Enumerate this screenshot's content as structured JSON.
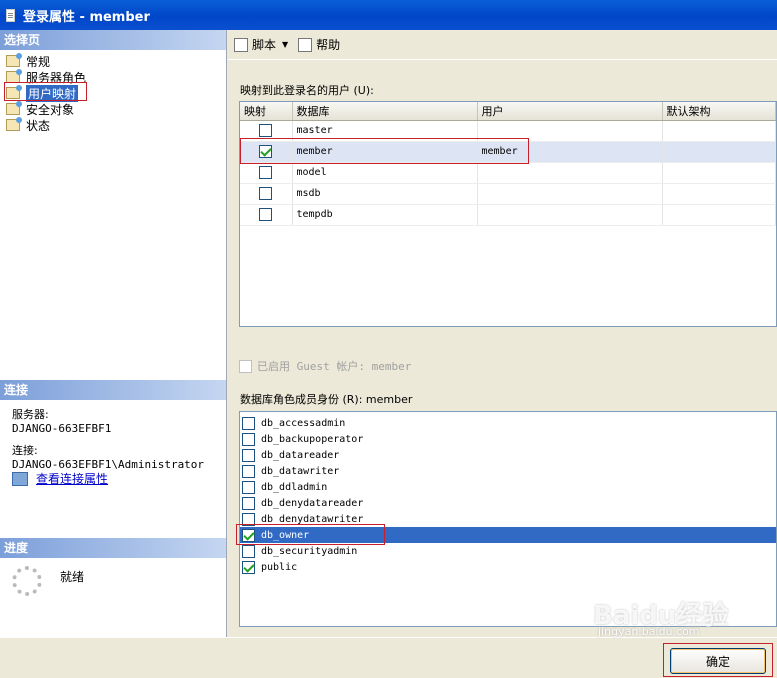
{
  "window": {
    "title": "登录属性 - member"
  },
  "left": {
    "select_page_header": "选择页",
    "pages": [
      {
        "label": "常规"
      },
      {
        "label": "服务器角色"
      },
      {
        "label": "用户映射"
      },
      {
        "label": "安全对象"
      },
      {
        "label": "状态"
      }
    ],
    "connection": {
      "header": "连接",
      "server_label": "服务器:",
      "server_value": "DJANGO-663EFBF1",
      "conn_label": "连接:",
      "conn_value": "DJANGO-663EFBF1\\Administrator",
      "view_link": "查看连接属性"
    },
    "progress": {
      "header": "进度",
      "status": "就绪"
    }
  },
  "toolbar": {
    "script_label": "脚本",
    "help_label": "帮助"
  },
  "mapping": {
    "label": "映射到此登录名的用户 (U):",
    "columns": [
      "映射",
      "数据库",
      "用户",
      "默认架构"
    ],
    "rows": [
      {
        "db": "master",
        "user": "",
        "schema": "",
        "mapped": false
      },
      {
        "db": "member",
        "user": "member",
        "schema": "",
        "mapped": true
      },
      {
        "db": "model",
        "user": "",
        "schema": "",
        "mapped": false
      },
      {
        "db": "msdb",
        "user": "",
        "schema": "",
        "mapped": false
      },
      {
        "db": "tempdb",
        "user": "",
        "schema": "",
        "mapped": false
      }
    ]
  },
  "guest": {
    "label": "已启用 Guest 帐户: member"
  },
  "roles": {
    "label": "数据库角色成员身份 (R): member",
    "items": [
      {
        "name": "db_accessadmin",
        "checked": false
      },
      {
        "name": "db_backupoperator",
        "checked": false
      },
      {
        "name": "db_datareader",
        "checked": false
      },
      {
        "name": "db_datawriter",
        "checked": false
      },
      {
        "name": "db_ddladmin",
        "checked": false
      },
      {
        "name": "db_denydatareader",
        "checked": false
      },
      {
        "name": "db_denydatawriter",
        "checked": false
      },
      {
        "name": "db_owner",
        "checked": true
      },
      {
        "name": "db_securityadmin",
        "checked": false
      },
      {
        "name": "public",
        "checked": true
      }
    ]
  },
  "footer": {
    "ok_label": "确定"
  },
  "watermark": {
    "logo": "Baidu经验",
    "url": "jingyan.baidu.com"
  }
}
